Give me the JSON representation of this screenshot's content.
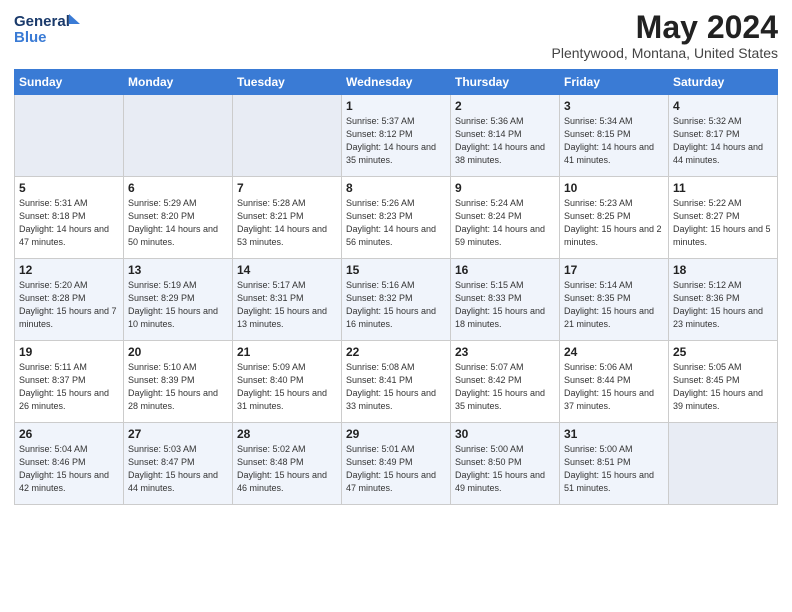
{
  "header": {
    "logo_line1": "General",
    "logo_line2": "Blue",
    "month": "May 2024",
    "location": "Plentywood, Montana, United States"
  },
  "days_of_week": [
    "Sunday",
    "Monday",
    "Tuesday",
    "Wednesday",
    "Thursday",
    "Friday",
    "Saturday"
  ],
  "weeks": [
    [
      {
        "day": "",
        "info": ""
      },
      {
        "day": "",
        "info": ""
      },
      {
        "day": "",
        "info": ""
      },
      {
        "day": "1",
        "info": "Sunrise: 5:37 AM\nSunset: 8:12 PM\nDaylight: 14 hours\nand 35 minutes."
      },
      {
        "day": "2",
        "info": "Sunrise: 5:36 AM\nSunset: 8:14 PM\nDaylight: 14 hours\nand 38 minutes."
      },
      {
        "day": "3",
        "info": "Sunrise: 5:34 AM\nSunset: 8:15 PM\nDaylight: 14 hours\nand 41 minutes."
      },
      {
        "day": "4",
        "info": "Sunrise: 5:32 AM\nSunset: 8:17 PM\nDaylight: 14 hours\nand 44 minutes."
      }
    ],
    [
      {
        "day": "5",
        "info": "Sunrise: 5:31 AM\nSunset: 8:18 PM\nDaylight: 14 hours\nand 47 minutes."
      },
      {
        "day": "6",
        "info": "Sunrise: 5:29 AM\nSunset: 8:20 PM\nDaylight: 14 hours\nand 50 minutes."
      },
      {
        "day": "7",
        "info": "Sunrise: 5:28 AM\nSunset: 8:21 PM\nDaylight: 14 hours\nand 53 minutes."
      },
      {
        "day": "8",
        "info": "Sunrise: 5:26 AM\nSunset: 8:23 PM\nDaylight: 14 hours\nand 56 minutes."
      },
      {
        "day": "9",
        "info": "Sunrise: 5:24 AM\nSunset: 8:24 PM\nDaylight: 14 hours\nand 59 minutes."
      },
      {
        "day": "10",
        "info": "Sunrise: 5:23 AM\nSunset: 8:25 PM\nDaylight: 15 hours\nand 2 minutes."
      },
      {
        "day": "11",
        "info": "Sunrise: 5:22 AM\nSunset: 8:27 PM\nDaylight: 15 hours\nand 5 minutes."
      }
    ],
    [
      {
        "day": "12",
        "info": "Sunrise: 5:20 AM\nSunset: 8:28 PM\nDaylight: 15 hours\nand 7 minutes."
      },
      {
        "day": "13",
        "info": "Sunrise: 5:19 AM\nSunset: 8:29 PM\nDaylight: 15 hours\nand 10 minutes."
      },
      {
        "day": "14",
        "info": "Sunrise: 5:17 AM\nSunset: 8:31 PM\nDaylight: 15 hours\nand 13 minutes."
      },
      {
        "day": "15",
        "info": "Sunrise: 5:16 AM\nSunset: 8:32 PM\nDaylight: 15 hours\nand 16 minutes."
      },
      {
        "day": "16",
        "info": "Sunrise: 5:15 AM\nSunset: 8:33 PM\nDaylight: 15 hours\nand 18 minutes."
      },
      {
        "day": "17",
        "info": "Sunrise: 5:14 AM\nSunset: 8:35 PM\nDaylight: 15 hours\nand 21 minutes."
      },
      {
        "day": "18",
        "info": "Sunrise: 5:12 AM\nSunset: 8:36 PM\nDaylight: 15 hours\nand 23 minutes."
      }
    ],
    [
      {
        "day": "19",
        "info": "Sunrise: 5:11 AM\nSunset: 8:37 PM\nDaylight: 15 hours\nand 26 minutes."
      },
      {
        "day": "20",
        "info": "Sunrise: 5:10 AM\nSunset: 8:39 PM\nDaylight: 15 hours\nand 28 minutes."
      },
      {
        "day": "21",
        "info": "Sunrise: 5:09 AM\nSunset: 8:40 PM\nDaylight: 15 hours\nand 31 minutes."
      },
      {
        "day": "22",
        "info": "Sunrise: 5:08 AM\nSunset: 8:41 PM\nDaylight: 15 hours\nand 33 minutes."
      },
      {
        "day": "23",
        "info": "Sunrise: 5:07 AM\nSunset: 8:42 PM\nDaylight: 15 hours\nand 35 minutes."
      },
      {
        "day": "24",
        "info": "Sunrise: 5:06 AM\nSunset: 8:44 PM\nDaylight: 15 hours\nand 37 minutes."
      },
      {
        "day": "25",
        "info": "Sunrise: 5:05 AM\nSunset: 8:45 PM\nDaylight: 15 hours\nand 39 minutes."
      }
    ],
    [
      {
        "day": "26",
        "info": "Sunrise: 5:04 AM\nSunset: 8:46 PM\nDaylight: 15 hours\nand 42 minutes."
      },
      {
        "day": "27",
        "info": "Sunrise: 5:03 AM\nSunset: 8:47 PM\nDaylight: 15 hours\nand 44 minutes."
      },
      {
        "day": "28",
        "info": "Sunrise: 5:02 AM\nSunset: 8:48 PM\nDaylight: 15 hours\nand 46 minutes."
      },
      {
        "day": "29",
        "info": "Sunrise: 5:01 AM\nSunset: 8:49 PM\nDaylight: 15 hours\nand 47 minutes."
      },
      {
        "day": "30",
        "info": "Sunrise: 5:00 AM\nSunset: 8:50 PM\nDaylight: 15 hours\nand 49 minutes."
      },
      {
        "day": "31",
        "info": "Sunrise: 5:00 AM\nSunset: 8:51 PM\nDaylight: 15 hours\nand 51 minutes."
      },
      {
        "day": "",
        "info": ""
      }
    ]
  ]
}
